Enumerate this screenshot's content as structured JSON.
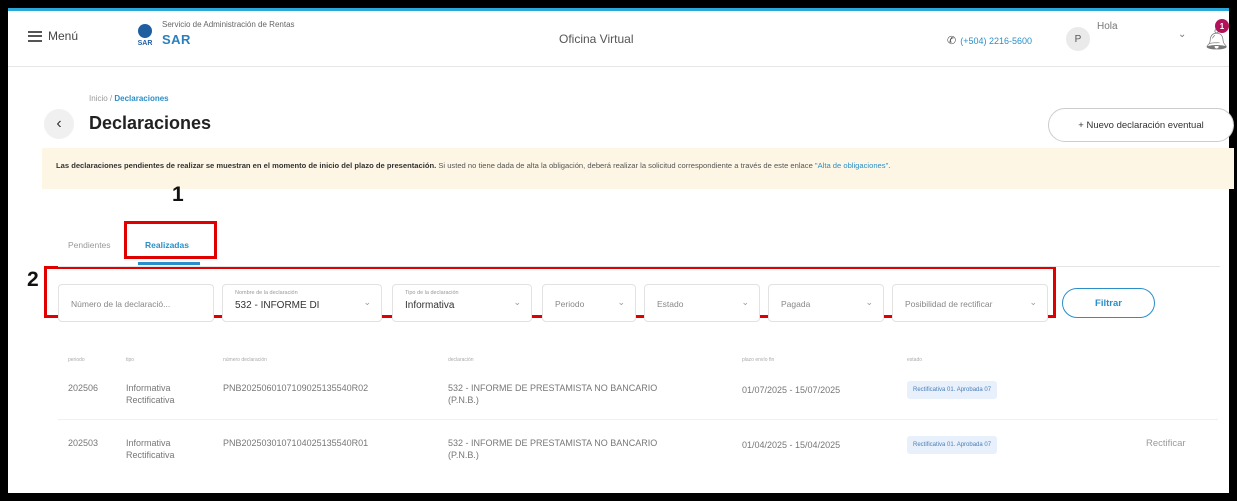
{
  "header": {
    "menu_label": "Menú",
    "logo_wordmark": "SAR",
    "org_name": "Servicio de Administración de Rentas",
    "app_name": "SAR",
    "oficina_label": "Oficina Virtual",
    "phone": "(+504) 2216-5600",
    "avatar_initial": "P",
    "greeting": "Hola",
    "notification_count": "1"
  },
  "breadcrumb": {
    "home": "Inicio",
    "separator": " / ",
    "current": "Declaraciones"
  },
  "page_title": "Declaraciones",
  "new_declaration_button": "+ Nuevo declaración eventual",
  "notice": {
    "bold_text": "Las declaraciones pendientes de realizar se muestran en el momento de inicio del plazo de presentación.",
    "text": " Si usted no tiene dada de alta la obligación, deberá realizar la solicitud correspondiente a través de este enlace ",
    "link_text": "\"Alta de obligaciones\"",
    "end": "."
  },
  "annotations": {
    "one": "1",
    "two": "2"
  },
  "tabs": [
    {
      "label": "Pendientes",
      "active": false
    },
    {
      "label": "Realizadas",
      "active": true
    }
  ],
  "filters": {
    "numero_placeholder": "Número de la declaració...",
    "nombre_label": "Nombre de la declaración",
    "nombre_value": "532 - INFORME DI",
    "tipo_label": "Tipo de la declaración",
    "tipo_value": "Informativa",
    "periodo_placeholder": "Periodo",
    "estado_placeholder": "Estado",
    "pagada_placeholder": "Pagada",
    "posibilidad_placeholder": "Posibilidad de rectificar",
    "filter_button": "Filtrar"
  },
  "table": {
    "headers": {
      "periodo": "periodo",
      "tipo": "tipo",
      "numero": "número declaración",
      "declaracion": "declaración",
      "plazo": "plazo envío fin",
      "estado": "estado"
    },
    "rows": [
      {
        "periodo": "202506",
        "tipo_1": "Informativa",
        "tipo_2": "Rectificativa",
        "numero": "PNB2025060107109025135540R02",
        "declaracion_1": "532 - INFORME DE PRESTAMISTA NO BANCARIO",
        "declaracion_2": "(P.N.B.)",
        "plazo": "01/07/2025 - 15/07/2025",
        "estado": "Rectificativa 01. Aprobada 07",
        "accion": ""
      },
      {
        "periodo": "202503",
        "tipo_1": "Informativa",
        "tipo_2": "Rectificativa",
        "numero": "PNB2025030107104025135540R01",
        "declaracion_1": "532 - INFORME DE PRESTAMISTA NO BANCARIO",
        "declaracion_2": "(P.N.B.)",
        "plazo": "01/04/2025 - 15/04/2025",
        "estado": "Rectificativa 01. Aprobada 07",
        "accion": "Rectificar"
      }
    ]
  },
  "colors": {
    "accent": "#2a8fc8",
    "annotation": "#e00000",
    "notice_bg": "#fdf6e4",
    "badge": "#b0135a"
  }
}
